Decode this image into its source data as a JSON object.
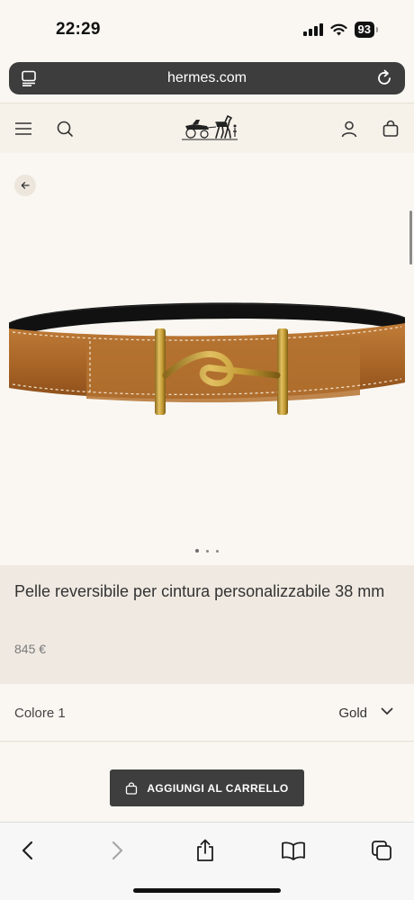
{
  "status": {
    "time": "22:29",
    "battery": "93"
  },
  "browser": {
    "url": "hermes.com"
  },
  "product": {
    "title": "Pelle reversibile per cintura personalizzabile 38 mm",
    "price": "845 €",
    "color_label": "Colore 1",
    "color_value": "Gold",
    "add_to_cart": "AGGIUNGI AL CARRELLO"
  },
  "icons": {
    "url_left": "tab-icon",
    "reload": "reload-icon",
    "menu": "menu-icon",
    "search": "search-icon",
    "account": "account-icon",
    "bag": "bag-icon",
    "back": "back-arrow-icon",
    "chevron": "chevron-down-icon",
    "nav_back": "chevron-left-icon",
    "nav_forward": "chevron-right-icon",
    "share": "share-icon",
    "bookmarks": "book-icon",
    "tabs": "tabs-icon"
  },
  "colors": {
    "leather": "#b06e2f",
    "leather_back": "#1a1a1a",
    "buckle": "#c9a43a",
    "button": "#3e3e3e"
  },
  "gallery": {
    "slides": 3,
    "active": 1
  }
}
